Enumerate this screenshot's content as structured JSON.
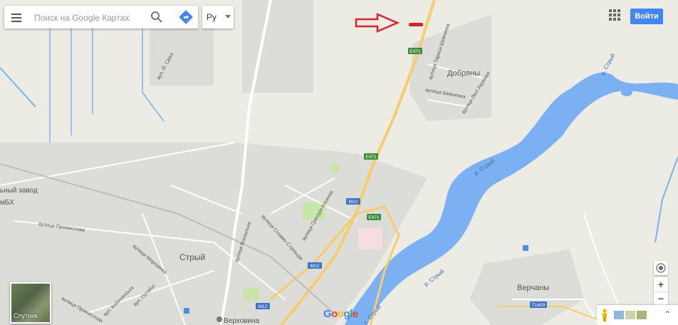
{
  "search": {
    "placeholder": "Поиск на Google Картах"
  },
  "language": {
    "label": "Ру"
  },
  "account": {
    "signin_label": "Войти"
  },
  "map_controls": {
    "zoom_in": "+",
    "zoom_out": "−"
  },
  "satellite": {
    "label": "Спутник"
  },
  "logo": {
    "letters": [
      "G",
      "o",
      "o",
      "g",
      "l",
      "e"
    ],
    "colors": [
      "#4285f4",
      "#ea4335",
      "#fbbc05",
      "#4285f4",
      "#34a853",
      "#ea4335"
    ]
  },
  "places": {
    "dobriany": "Добряны",
    "stryi": "Стрый",
    "verchany": "Верчаны",
    "verkhovyna": "Верховина",
    "zavod": "ьный завод",
    "mbkh": "мБХ"
  },
  "streets": {
    "ivan_sirko": "вул. Й. Сірка",
    "shevchenko_terrace": "вулиця Тараса Шевченка",
    "shevchenko": "вулиця Шевченка",
    "lesi_ukrainky": "вулиця Лесі Українки",
    "promyslova": "вулиця Промислова",
    "morozhnaya": "вулиця Морозенка",
    "vokzalna": "вулиця Вокзальна",
    "sichovykh_striltsiv": "вулиця Січових Стрільців",
    "hryhoriya_kosynky": "вулиця Григорія Косинки",
    "promyslova2": "вулиця Промислова",
    "potebni": "вул. Потебні",
    "koblyanska": "вул. Кобилянська"
  },
  "river_labels": [
    "р. Стрый",
    "р. Стрый",
    "р. Стрый",
    "р. Стрый"
  ],
  "road_shields": {
    "e471": "E471",
    "m12": "M12",
    "t1409": "T1409"
  },
  "colors": {
    "land": "#ecebe4",
    "urban": "#d9d9d6",
    "water": "#7bb1f2",
    "highway": "#f7cd6b",
    "road": "#ffffff",
    "park": "#c8e6a8",
    "annotation": "#e0232b",
    "button_blue": "#4285f4"
  },
  "icons": {
    "menu": "hamburger-menu-icon",
    "search": "search-icon",
    "directions": "directions-icon",
    "apps": "apps-grid-icon",
    "locate": "my-location-icon",
    "pegman": "pegman-icon",
    "expand": "expand-icon"
  }
}
